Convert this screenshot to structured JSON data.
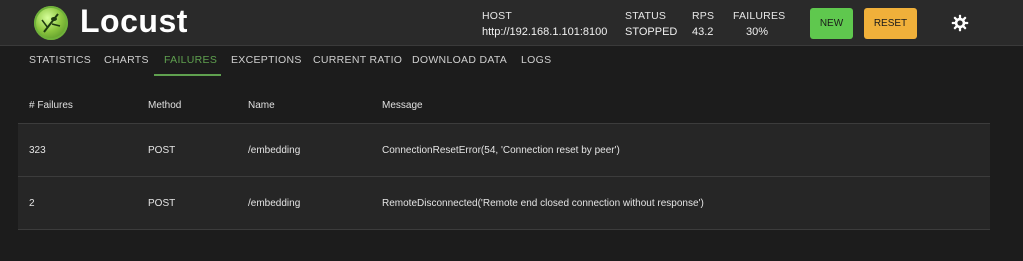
{
  "app": {
    "title": "Locust"
  },
  "stats": {
    "host_label": "HOST",
    "host_value": "http://192.168.1.101:8100",
    "status_label": "STATUS",
    "status_value": "STOPPED",
    "rps_label": "RPS",
    "rps_value": "43.2",
    "failures_label": "FAILURES",
    "failures_value": "30%"
  },
  "buttons": {
    "new_label": "NEW",
    "reset_label": "RESET"
  },
  "tabs": [
    {
      "label": "STATISTICS"
    },
    {
      "label": "CHARTS"
    },
    {
      "label": "FAILURES",
      "active": true
    },
    {
      "label": "EXCEPTIONS"
    },
    {
      "label": "CURRENT RATIO"
    },
    {
      "label": "DOWNLOAD DATA"
    },
    {
      "label": "LOGS"
    }
  ],
  "table": {
    "headers": [
      "# Failures",
      "Method",
      "Name",
      "Message"
    ],
    "rows": [
      [
        "323",
        "POST",
        "/embedding",
        "ConnectionResetError(54, 'Connection reset by peer')"
      ],
      [
        "2",
        "POST",
        "/embedding",
        "RemoteDisconnected('Remote end closed connection without response')"
      ]
    ]
  },
  "colors": {
    "accent": "#5fa04f",
    "new_button": "#5fc84e",
    "reset_button": "#f0b03a",
    "background": "#1c1c1c",
    "header": "#2a2a2a"
  },
  "icons": {
    "logo": "locust-logo-icon",
    "settings": "gear-icon"
  }
}
